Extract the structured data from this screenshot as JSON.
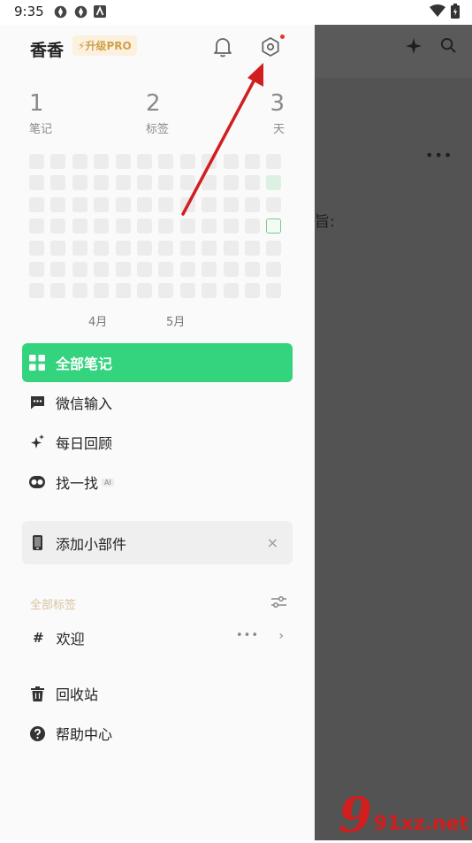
{
  "status_bar": {
    "time": "9:35",
    "left_icons": [
      "sync-icon",
      "sync-icon",
      "app-icon"
    ],
    "right_icons": [
      "wifi-icon",
      "battery-icon"
    ]
  },
  "drawer": {
    "user_name": "香香",
    "pro_badge": "升级PRO",
    "stats": [
      {
        "value": "1",
        "label": "笔记"
      },
      {
        "value": "2",
        "label": "标签"
      },
      {
        "value": "3",
        "label": "天"
      }
    ],
    "heatmap": {
      "columns": 12,
      "rows": 7,
      "highlighted": [
        {
          "col": 11,
          "row": 1,
          "level": "light"
        },
        {
          "col": 11,
          "row": 3,
          "level": "today"
        }
      ]
    },
    "months": [
      "4月",
      "5月"
    ],
    "nav": [
      {
        "label": "全部笔记",
        "icon": "grid-icon",
        "active": true
      },
      {
        "label": "微信输入",
        "icon": "chat-icon",
        "active": false
      },
      {
        "label": "每日回顾",
        "icon": "sparkle-icon",
        "active": false
      },
      {
        "label": "找一找",
        "icon": "glasses-icon",
        "active": false,
        "badge": "AI"
      }
    ],
    "widget": {
      "label": "添加小部件",
      "close": "×"
    },
    "tags_section": {
      "title": "全部标签",
      "items": [
        {
          "hash": "#",
          "label": "欢迎",
          "more": "•••",
          "chevron": "›"
        }
      ]
    },
    "bottom_nav": [
      {
        "label": "回收站",
        "icon": "trash-icon"
      },
      {
        "label": "帮助中心",
        "icon": "help-icon"
      }
    ]
  },
  "background": {
    "more": "•••",
    "partial_text": "旨:"
  },
  "watermark": {
    "logo": "9",
    "text": "91xz.net"
  },
  "colors": {
    "accent": "#34d37e",
    "pro_text": "#d0a14a",
    "annotation_arrow": "#d11e1e",
    "notification_dot": "#e0392b"
  }
}
